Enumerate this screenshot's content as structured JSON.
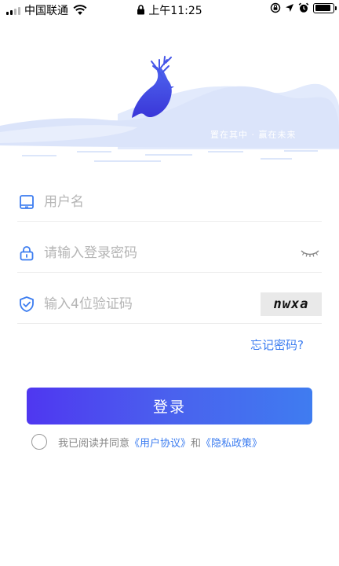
{
  "status_bar": {
    "carrier": "中国联通",
    "time": "上午11:25",
    "icons": [
      "signal-icon",
      "wifi-icon",
      "lock-icon",
      "orientation-lock-icon",
      "location-icon",
      "alarm-icon",
      "battery-icon"
    ],
    "battery_level": 0.9
  },
  "header": {
    "slogan": "置在其中 · 赢在未来",
    "logo": "deer-icon"
  },
  "form": {
    "username": {
      "placeholder": "用户名",
      "icon": "tablet-icon"
    },
    "password": {
      "placeholder": "请输入登录密码",
      "icon": "lock-icon",
      "toggle_icon": "eye-closed-icon"
    },
    "captcha": {
      "placeholder": "输入4位验证码",
      "icon": "shield-icon",
      "code": "nwxa"
    }
  },
  "forgot_password": "忘记密码?",
  "login_button": "登录",
  "agreement": {
    "prefix": "我已阅读并同意",
    "user_agreement": "《用户协议》",
    "and": "和",
    "privacy_policy": "《隐私政策》"
  },
  "colors": {
    "accent": "#3b7cf0",
    "button_start": "#4f37f0",
    "button_end": "#3f7cf0",
    "mountain": "#dce6fb"
  }
}
